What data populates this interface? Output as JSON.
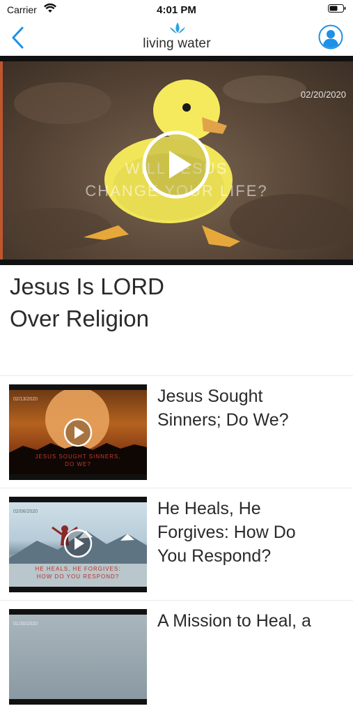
{
  "status_bar": {
    "carrier": "Carrier",
    "time": "4:01 PM"
  },
  "nav": {
    "logo_text": "living water",
    "logo_color": "#29a3e0",
    "accent_color": "#1e90e6",
    "back_icon": "chevron-left-icon",
    "profile_icon": "user-circle-icon"
  },
  "hero": {
    "date": "02/20/2020",
    "caption_lines": [
      "WILL JESUS",
      "CHANGE YOUR LIFE?"
    ],
    "play_icon": "play-icon"
  },
  "main": {
    "title_lines": [
      "Jesus Is LORD",
      "Over Religion"
    ]
  },
  "videos": [
    {
      "date": "02/13/2020",
      "caption_lines": [
        "JESUS SOUGHT SINNERS,",
        "DO WE?"
      ],
      "title_lines": [
        "Jesus Sought",
        "Sinners; Do We?"
      ]
    },
    {
      "date": "02/06/2020",
      "caption_lines": [
        "HE HEALS, HE FORGIVES:",
        "HOW DO YOU RESPOND?"
      ],
      "title_lines": [
        "He Heals, He",
        "Forgives: How Do",
        "You Respond?"
      ]
    },
    {
      "date": "01/30/2020",
      "caption_lines": [],
      "title_lines": [
        "A Mission to Heal, a"
      ]
    }
  ]
}
